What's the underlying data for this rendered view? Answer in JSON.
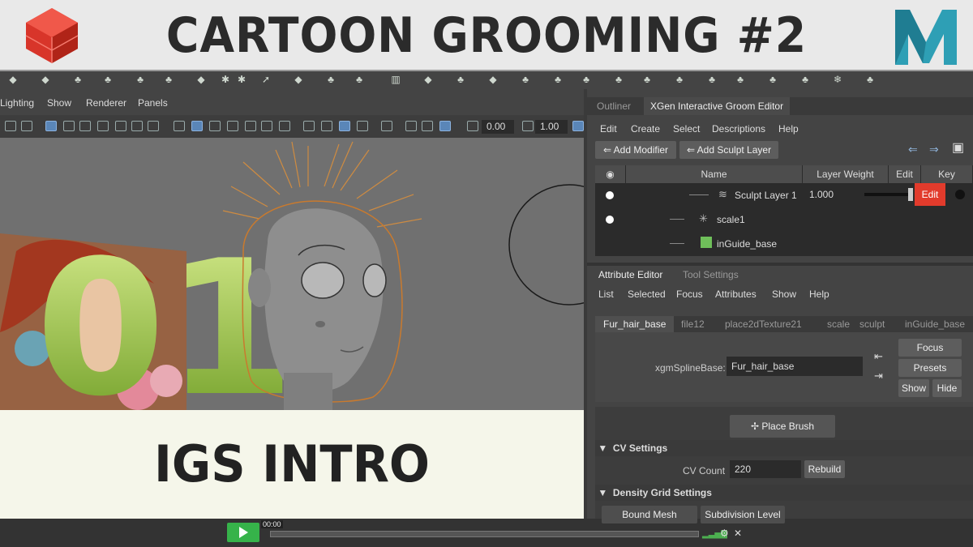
{
  "banner": {
    "title": "CARTOON GROOMING #2",
    "left_logo": "redshift-cube-logo",
    "right_logo": "maya-m-logo"
  },
  "viewport": {
    "menu": [
      "Lighting",
      "Show",
      "Renderer",
      "Panels"
    ],
    "field_a": "0.00",
    "field_b": "1.00",
    "overlay_number": "01"
  },
  "intro": {
    "title": "IGS INTRO"
  },
  "player": {
    "timecode": "00:00",
    "progress": 0.0
  },
  "groom_editor": {
    "tabs": [
      "Outliner",
      "XGen Interactive Groom Editor"
    ],
    "menu": [
      "Edit",
      "Create",
      "Select",
      "Descriptions",
      "Help"
    ],
    "add_modifier": "Add Modifier",
    "add_sculpt_layer": "Add Sculpt Layer",
    "columns": {
      "name": "Name",
      "weight": "Layer Weight",
      "edit": "Edit",
      "key": "Key"
    },
    "rows": [
      {
        "name": "Sculpt Layer 1",
        "weight": "1.000",
        "edit": "Edit"
      },
      {
        "name": "scale1"
      },
      {
        "name": "inGuide_base"
      }
    ]
  },
  "attribute_editor": {
    "tabs": [
      "Attribute Editor",
      "Tool Settings"
    ],
    "menu": [
      "List",
      "Selected",
      "Focus",
      "Attributes",
      "Show",
      "Help"
    ],
    "node_tabs": [
      "Fur_hair_base",
      "file12",
      "place2dTexture21",
      "scale",
      "sculpt",
      "inGuide_base"
    ],
    "field_label": "xgmSplineBase:",
    "field_value": "Fur_hair_base",
    "focus": "Focus",
    "presets": "Presets",
    "show": "Show",
    "hide": "Hide",
    "place_brush": "Place Brush",
    "cv_section": "CV Settings",
    "cv_count_label": "CV Count",
    "cv_count_value": "220",
    "rebuild": "Rebuild",
    "density_section": "Density Grid Settings",
    "bound_mesh": "Bound Mesh",
    "subdivision": "Subdivision Level"
  },
  "colors": {
    "accent_red": "#e23b2c",
    "play_green": "#36b34a",
    "number_green": "#8fc43d"
  }
}
